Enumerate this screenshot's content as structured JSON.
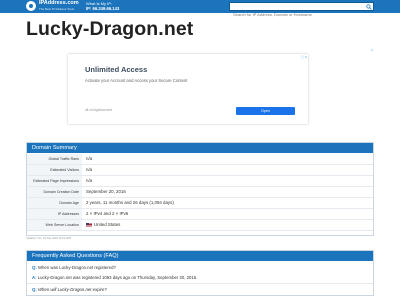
{
  "header": {
    "site_name": "IPAddress.com",
    "tagline": "The Best IP Address Tools",
    "myip_label": "What Is My IP:",
    "myip_value": "IP: 66.249.66.143",
    "search_placeholder": "Search for IP Address, Domain or Hostname"
  },
  "page_title": "Lucky-Dragon.net",
  "ad": {
    "title": "Unlimited Access",
    "subtitle": "Activate your Account and Access your Secure Content",
    "url": "all-in1digitalcontent",
    "button": "Open",
    "info_icon": "info-icon",
    "close_icon": "close-icon"
  },
  "summary": {
    "heading": "Domain Summary",
    "rows": [
      {
        "label": "Global Traffic Rank",
        "value": "n/a"
      },
      {
        "label": "Estimated Visitors",
        "value": "n/a"
      },
      {
        "label": "Estimated Page Impressions",
        "value": "n/a"
      },
      {
        "label": "Domain Creation Date",
        "value": "September 20, 2016"
      },
      {
        "label": "Domain Age",
        "value": "2 years, 11 months and 26 days (1,094 days)"
      },
      {
        "label": "IP Addresses",
        "value": "2 × IPv4 and 2 × IPv6"
      },
      {
        "label": "Web Server Location",
        "value": "United States"
      }
    ],
    "updated": "Updated: Tue, 15 Sep 2019 10:23 GMT"
  },
  "faq": {
    "heading": "Frequently Asked Questions (FAQ)",
    "items": [
      {
        "q_prefix": "Q:",
        "q": "When was Lucky-Dragon.net registered?",
        "a_prefix": "A:",
        "a": "Lucky-Dragon.net was registered 1093 days ago on Thursday, September 20, 2016."
      },
      {
        "q_prefix": "Q:",
        "q": "When will Lucky-Dragon.net expire?"
      }
    ]
  }
}
